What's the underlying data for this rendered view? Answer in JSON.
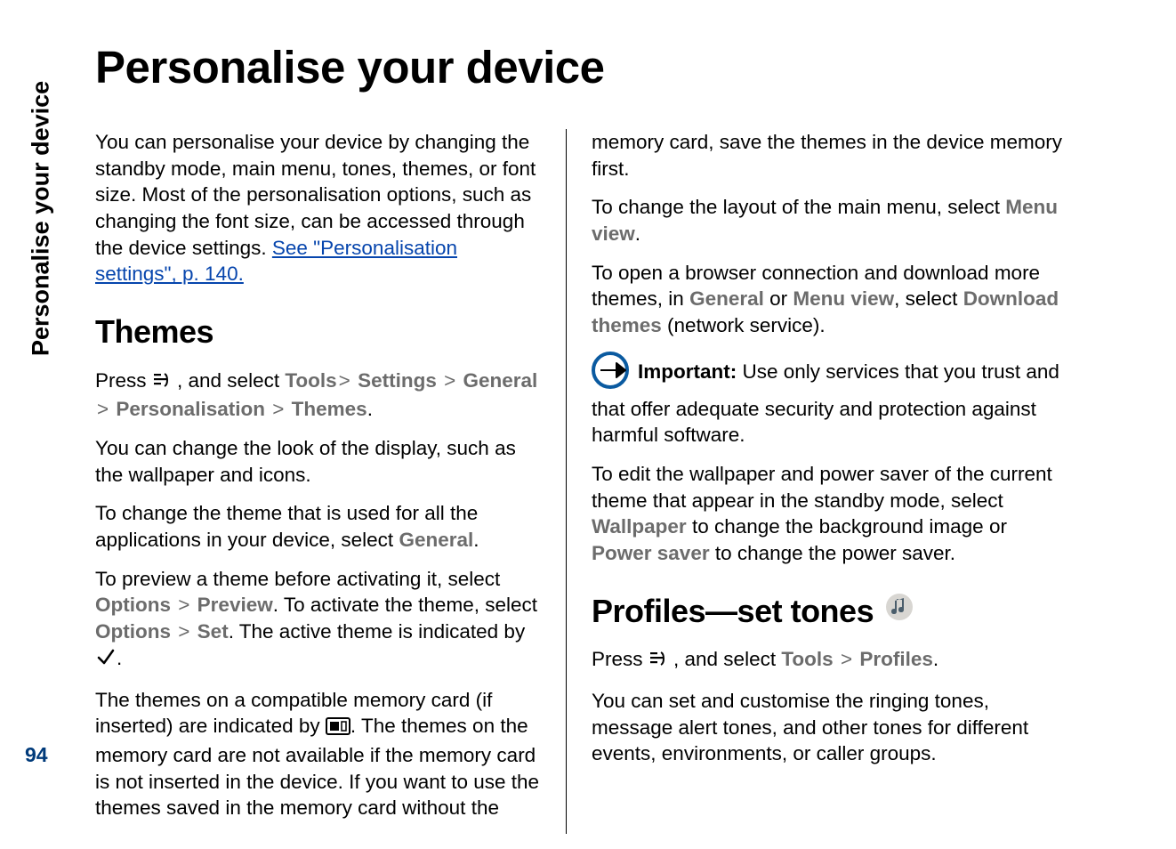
{
  "sideTab": "Personalise your device",
  "pageNumber": "94",
  "title": "Personalise your device",
  "left": {
    "intro": {
      "pre": "You can personalise your device by changing the standby mode, main menu, tones, themes, or font size. Most of the personalisation options, such as changing the font size, can be accessed through the device settings. ",
      "link": "See \"Personalisation settings\", p. 140."
    },
    "themesHeading": "Themes",
    "p1": {
      "press": "Press ",
      "afterIcon": " , and select ",
      "m1": "Tools",
      "m2": "Settings",
      "m3": "General",
      "m4": "Personalisation",
      "m5": "Themes",
      "end": "."
    },
    "p2": "You can change the look of the display, such as the wallpaper and icons.",
    "p3": {
      "pre": "To change the theme that is used for all the applications in your device, select ",
      "m": "General",
      "end": "."
    },
    "p4": {
      "a": "To preview a theme before activating it, select ",
      "m1": "Options",
      "m2": "Preview",
      "b": ". To activate the theme, select ",
      "m3": "Options",
      "m4": "Set",
      "c": ". The active theme is indicated by ",
      "end": "."
    },
    "p5": {
      "a": "The themes on a compatible memory card (if inserted) are indicated by ",
      "b": ". The themes on the memory card are not available if the memory card is not inserted in the device. If you want to use the themes saved in the memory card without the"
    }
  },
  "right": {
    "p0": "memory card, save the themes in the device memory first.",
    "p1": {
      "a": "To change the layout of the main menu, select ",
      "m": "Menu view",
      "end": "."
    },
    "p2": {
      "a": "To open a browser connection and download more themes, in ",
      "m1": "General",
      "or": " or ",
      "m2": "Menu view",
      "b": ", select ",
      "m3": "Download themes",
      "end": " (network service)."
    },
    "notice": {
      "label": "Important:",
      "body": "  Use only services that you trust and that offer adequate security and protection against harmful software."
    },
    "p3": {
      "a": "To edit the wallpaper and power saver of the current theme that appear in the standby mode, select ",
      "m1": "Wallpaper",
      "b": " to change the background image or ",
      "m2": "Power saver",
      "c": " to change the power saver."
    },
    "profilesHeading": "Profiles—set tones",
    "p4": {
      "press": "Press ",
      "afterIcon": " , and select ",
      "m1": "Tools",
      "m2": "Profiles",
      "end": "."
    },
    "p5": "You can set and customise the ringing tones, message alert tones, and other tones for different events, environments, or caller groups."
  },
  "gt": ">"
}
